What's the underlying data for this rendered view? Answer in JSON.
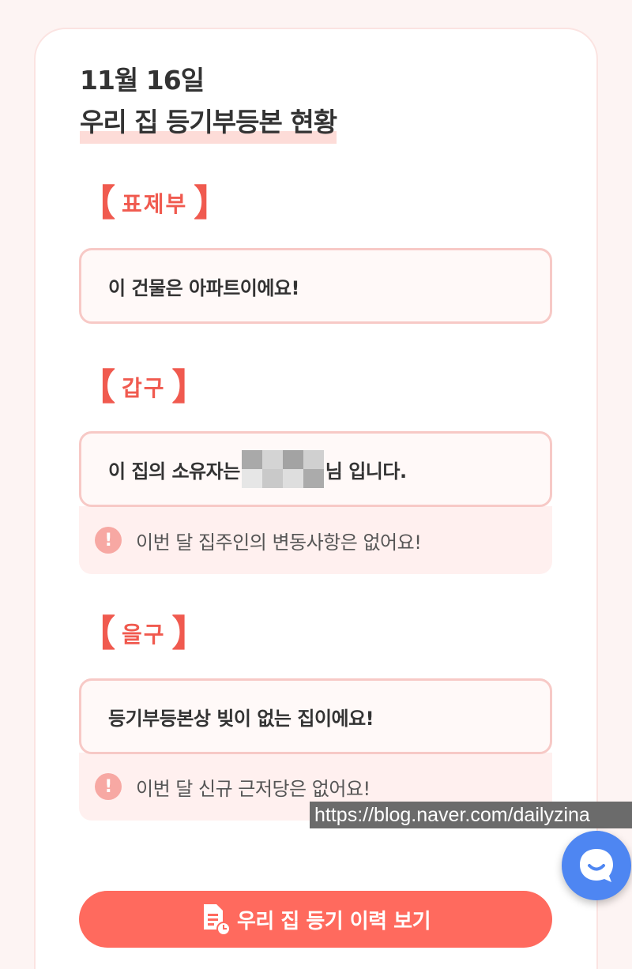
{
  "header": {
    "date": "11월 16일",
    "title": "우리 집 등기부등본 현황"
  },
  "sections": {
    "pyojebu": {
      "label": "표제부",
      "info": "이 건물은 아파트이에요!"
    },
    "gapgu": {
      "label": "갑구",
      "info_prefix": "이 집의 소유자는",
      "info_suffix": "님 입니다.",
      "notice": "이번 달 집주인의 변동사항은 없어요!"
    },
    "eulgu": {
      "label": "을구",
      "info": "등기부등본상 빚이 없는 집이에요!",
      "notice": "이번 달 신규 근저당은 없어요!"
    }
  },
  "button": {
    "label": "우리 집 등기 이력 보기"
  },
  "watermark": "https://blog.naver.com/dailyzina",
  "icons": {
    "warning": "exclamation-circle-icon",
    "document": "document-clock-icon",
    "chat": "chat-bubble-icon"
  },
  "colors": {
    "accent": "#f05a4f",
    "button": "#ff6a5e",
    "box_border": "#f7c9c6",
    "notice_bg": "#fff0ef",
    "chat": "#4e86f2"
  }
}
